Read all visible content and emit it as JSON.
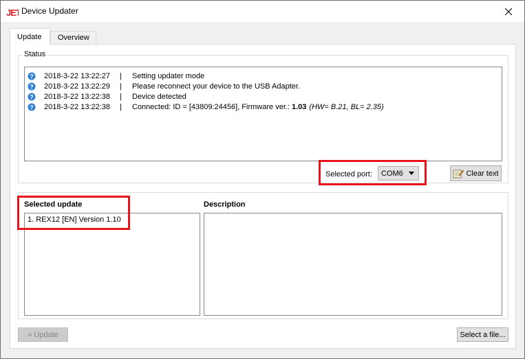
{
  "window": {
    "title": "Device Updater",
    "logo_text": "JETI"
  },
  "tabs": [
    {
      "label": "Update",
      "active": true
    },
    {
      "label": "Overview",
      "active": false
    }
  ],
  "status": {
    "group_label": "Status",
    "log": [
      {
        "time": "2018-3-22 13:22:27",
        "sep": "|",
        "message": "Setting updater mode"
      },
      {
        "time": "2018-3-22 13:22:29",
        "sep": "|",
        "message": "Please reconnect your device to the USB Adapter."
      },
      {
        "time": "2018-3-22 13:22:38",
        "sep": "|",
        "message": "Device detected"
      },
      {
        "time": "2018-3-22 13:22:38",
        "sep": "|",
        "message": "Connected: ID = [43809:24456], Firmware ver.:",
        "bold": "1.03",
        "italic": "(HW= B.21, BL= 2.35)"
      }
    ],
    "port_label": "Selected port:",
    "port_value": "COM6",
    "clear_label": "Clear text"
  },
  "updates": {
    "selected_label": "Selected update",
    "description_label": "Description",
    "items": [
      "1. REX12 [EN] Version  1.10"
    ]
  },
  "footer": {
    "update_label": "Update",
    "update_prefix": "»",
    "select_file_label": "Select a file..."
  },
  "colors": {
    "highlight": "#e8141b",
    "logo": "#d9262c",
    "info_icon": "#2e7fd6"
  }
}
